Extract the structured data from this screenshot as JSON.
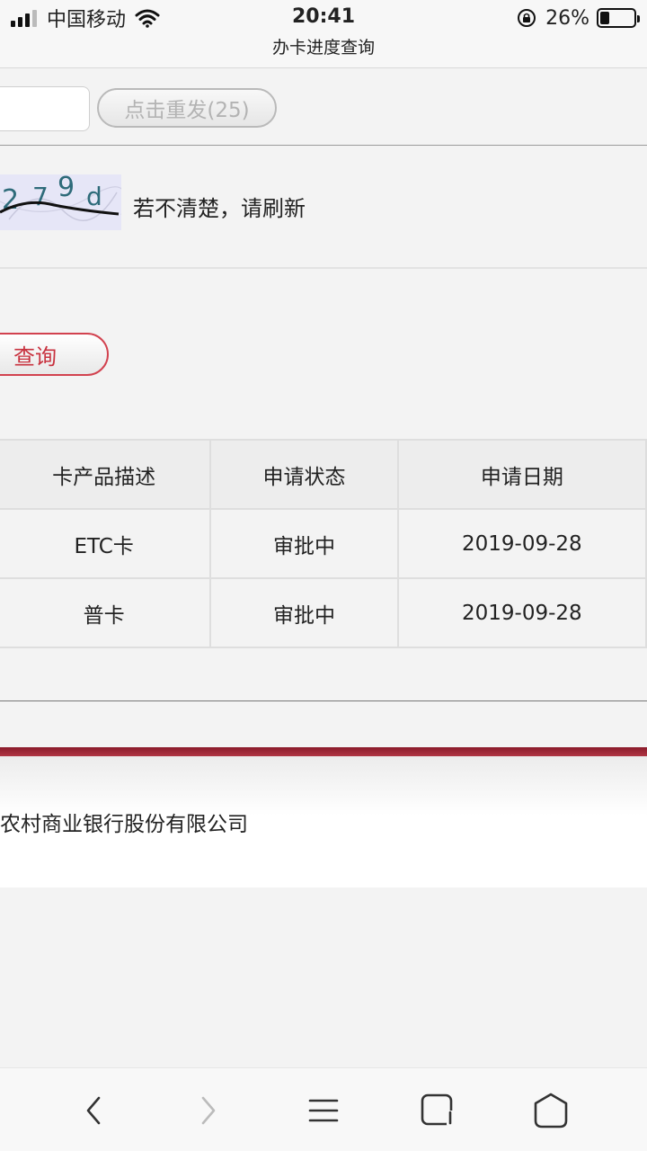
{
  "status_bar": {
    "carrier": "中国移动",
    "time": "20:41",
    "page_title": "办卡进度查询",
    "battery_percent": "26%"
  },
  "form": {
    "resend_label": "点击重发(25)",
    "captcha_text": "279d",
    "captcha_hint": "若不清楚，请刷新",
    "query_label": "查询"
  },
  "results": {
    "headers": [
      "卡产品描述",
      "申请状态",
      "申请日期"
    ],
    "rows": [
      [
        "ETC卡",
        "审批中",
        "2019-09-28"
      ],
      [
        "普卡",
        "审批中",
        "2019-09-28"
      ]
    ]
  },
  "footer": {
    "text": "农村商业银行股份有限公司"
  },
  "nav": {
    "icons": [
      "back-icon",
      "forward-icon",
      "menu-icon",
      "tabs-icon",
      "home-icon"
    ]
  },
  "colors": {
    "accent_red": "#c8323f",
    "footer_bar": "#8a1b2b"
  }
}
